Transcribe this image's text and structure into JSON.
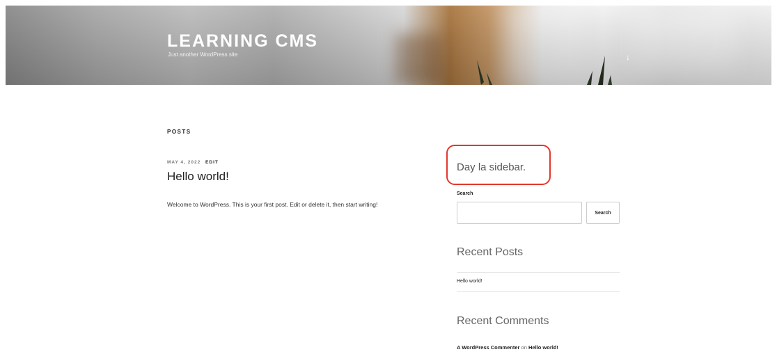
{
  "header": {
    "site_title": "LEARNING CMS",
    "site_description": "Just another WordPress site",
    "scroll_glyph": "↓"
  },
  "main": {
    "heading": "POSTS",
    "post": {
      "date": "MAY 4, 2022",
      "edit_label": "EDIT",
      "title": "Hello world!",
      "excerpt": "Welcome to WordPress. This is your first post. Edit or delete it, then start writing!"
    }
  },
  "sidebar": {
    "title": "Day la sidebar.",
    "search": {
      "label": "Search",
      "placeholder": "",
      "button_label": "Search"
    },
    "recent_posts": {
      "title": "Recent Posts",
      "items": [
        "Hello world!"
      ]
    },
    "recent_comments": {
      "title": "Recent Comments",
      "author": "A WordPress Commenter",
      "connector": "on",
      "post": "Hello world!"
    }
  },
  "colors": {
    "highlight": "#e2382c"
  }
}
